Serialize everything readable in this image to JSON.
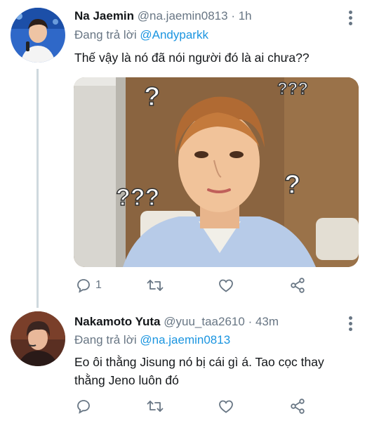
{
  "tweets": [
    {
      "name": "Na Jaemin",
      "handle": "@na.jaemin0813",
      "separator": "·",
      "time": "1h",
      "replying_prefix": "Đang trả lời",
      "replying_to": "@Andyparkk",
      "text": "Thế vậy là nó đã nói người đó là ai chưa??",
      "media_overlay": {
        "q1": "?",
        "q2": "???",
        "q3": "???",
        "q4": "?"
      },
      "actions": {
        "reply_count": "1",
        "retweet_count": "",
        "like_count": ""
      }
    },
    {
      "name": "Nakamoto Yuta",
      "handle": "@yuu_taa2610",
      "separator": "·",
      "time": "43m",
      "replying_prefix": "Đang trả lời",
      "replying_to": "@na.jaemin0813",
      "text_lines": [
        "Eo ôi thằng Jisung nó bị cái gì á. Tao cọc thay",
        "thằng Jeno luôn đó"
      ],
      "actions": {
        "reply_count": "",
        "retweet_count": "",
        "like_count": ""
      }
    }
  ],
  "colors": {
    "accent": "#1b95e0",
    "secondary_text": "#687684",
    "thread_line": "#cfd9de"
  },
  "icons": [
    "more-vertical-icon",
    "reply-icon",
    "retweet-icon",
    "like-icon",
    "share-icon"
  ]
}
